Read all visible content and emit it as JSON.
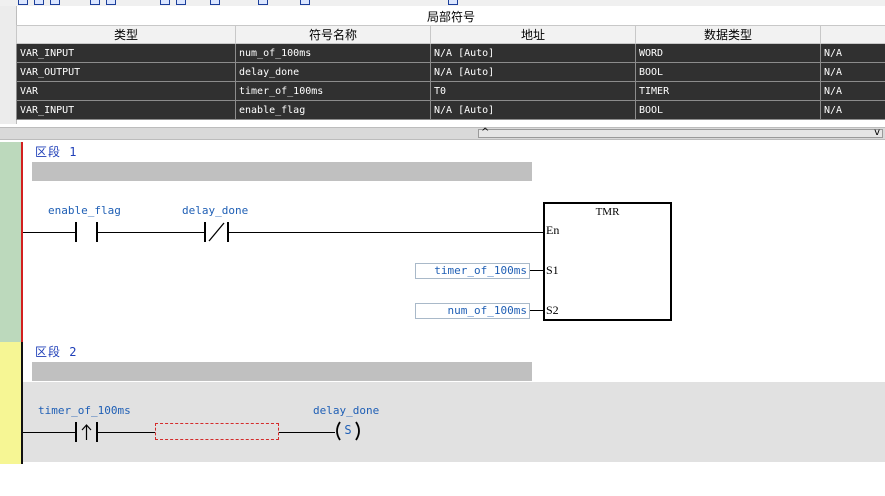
{
  "symbol_table": {
    "group_header": "局部符号",
    "columns": [
      "类型",
      "符号名称",
      "地址",
      "数据类型",
      ""
    ],
    "rows": [
      {
        "type": "VAR_INPUT",
        "name": "num_of_100ms",
        "address": "N/A [Auto]",
        "datatype": "WORD",
        "extra": "N/A"
      },
      {
        "type": "VAR_OUTPUT",
        "name": "delay_done",
        "address": "N/A [Auto]",
        "datatype": "BOOL",
        "extra": "N/A"
      },
      {
        "type": "VAR",
        "name": "timer_of_100ms",
        "address": "T0",
        "datatype": "TIMER",
        "extra": "N/A"
      },
      {
        "type": "VAR_INPUT",
        "name": "enable_flag",
        "address": "N/A [Auto]",
        "datatype": "BOOL",
        "extra": "N/A"
      }
    ]
  },
  "splitter": {
    "arrow_left": "^",
    "arrow_right": "v"
  },
  "ladder": {
    "segments": [
      {
        "title": "区段 1",
        "contact1_label": "enable_flag",
        "contact2_label": "delay_done",
        "block": {
          "name": "TMR",
          "pin_en": "En",
          "pin_s1": "S1",
          "pin_s2": "S2"
        },
        "operand_s1": "timer_of_100ms",
        "operand_s2": "num_of_100ms"
      },
      {
        "title": "区段 2",
        "contact_label": "timer_of_100ms",
        "coil_label": "delay_done",
        "coil_type": "S"
      }
    ]
  },
  "colors": {
    "segment1_gutter": "#bcd9bc",
    "segment2_gutter": "#f6f694",
    "active_rail": "#d21f1f",
    "variable_text": "#1f5fb5",
    "segment_title": "#1f3fb8"
  }
}
